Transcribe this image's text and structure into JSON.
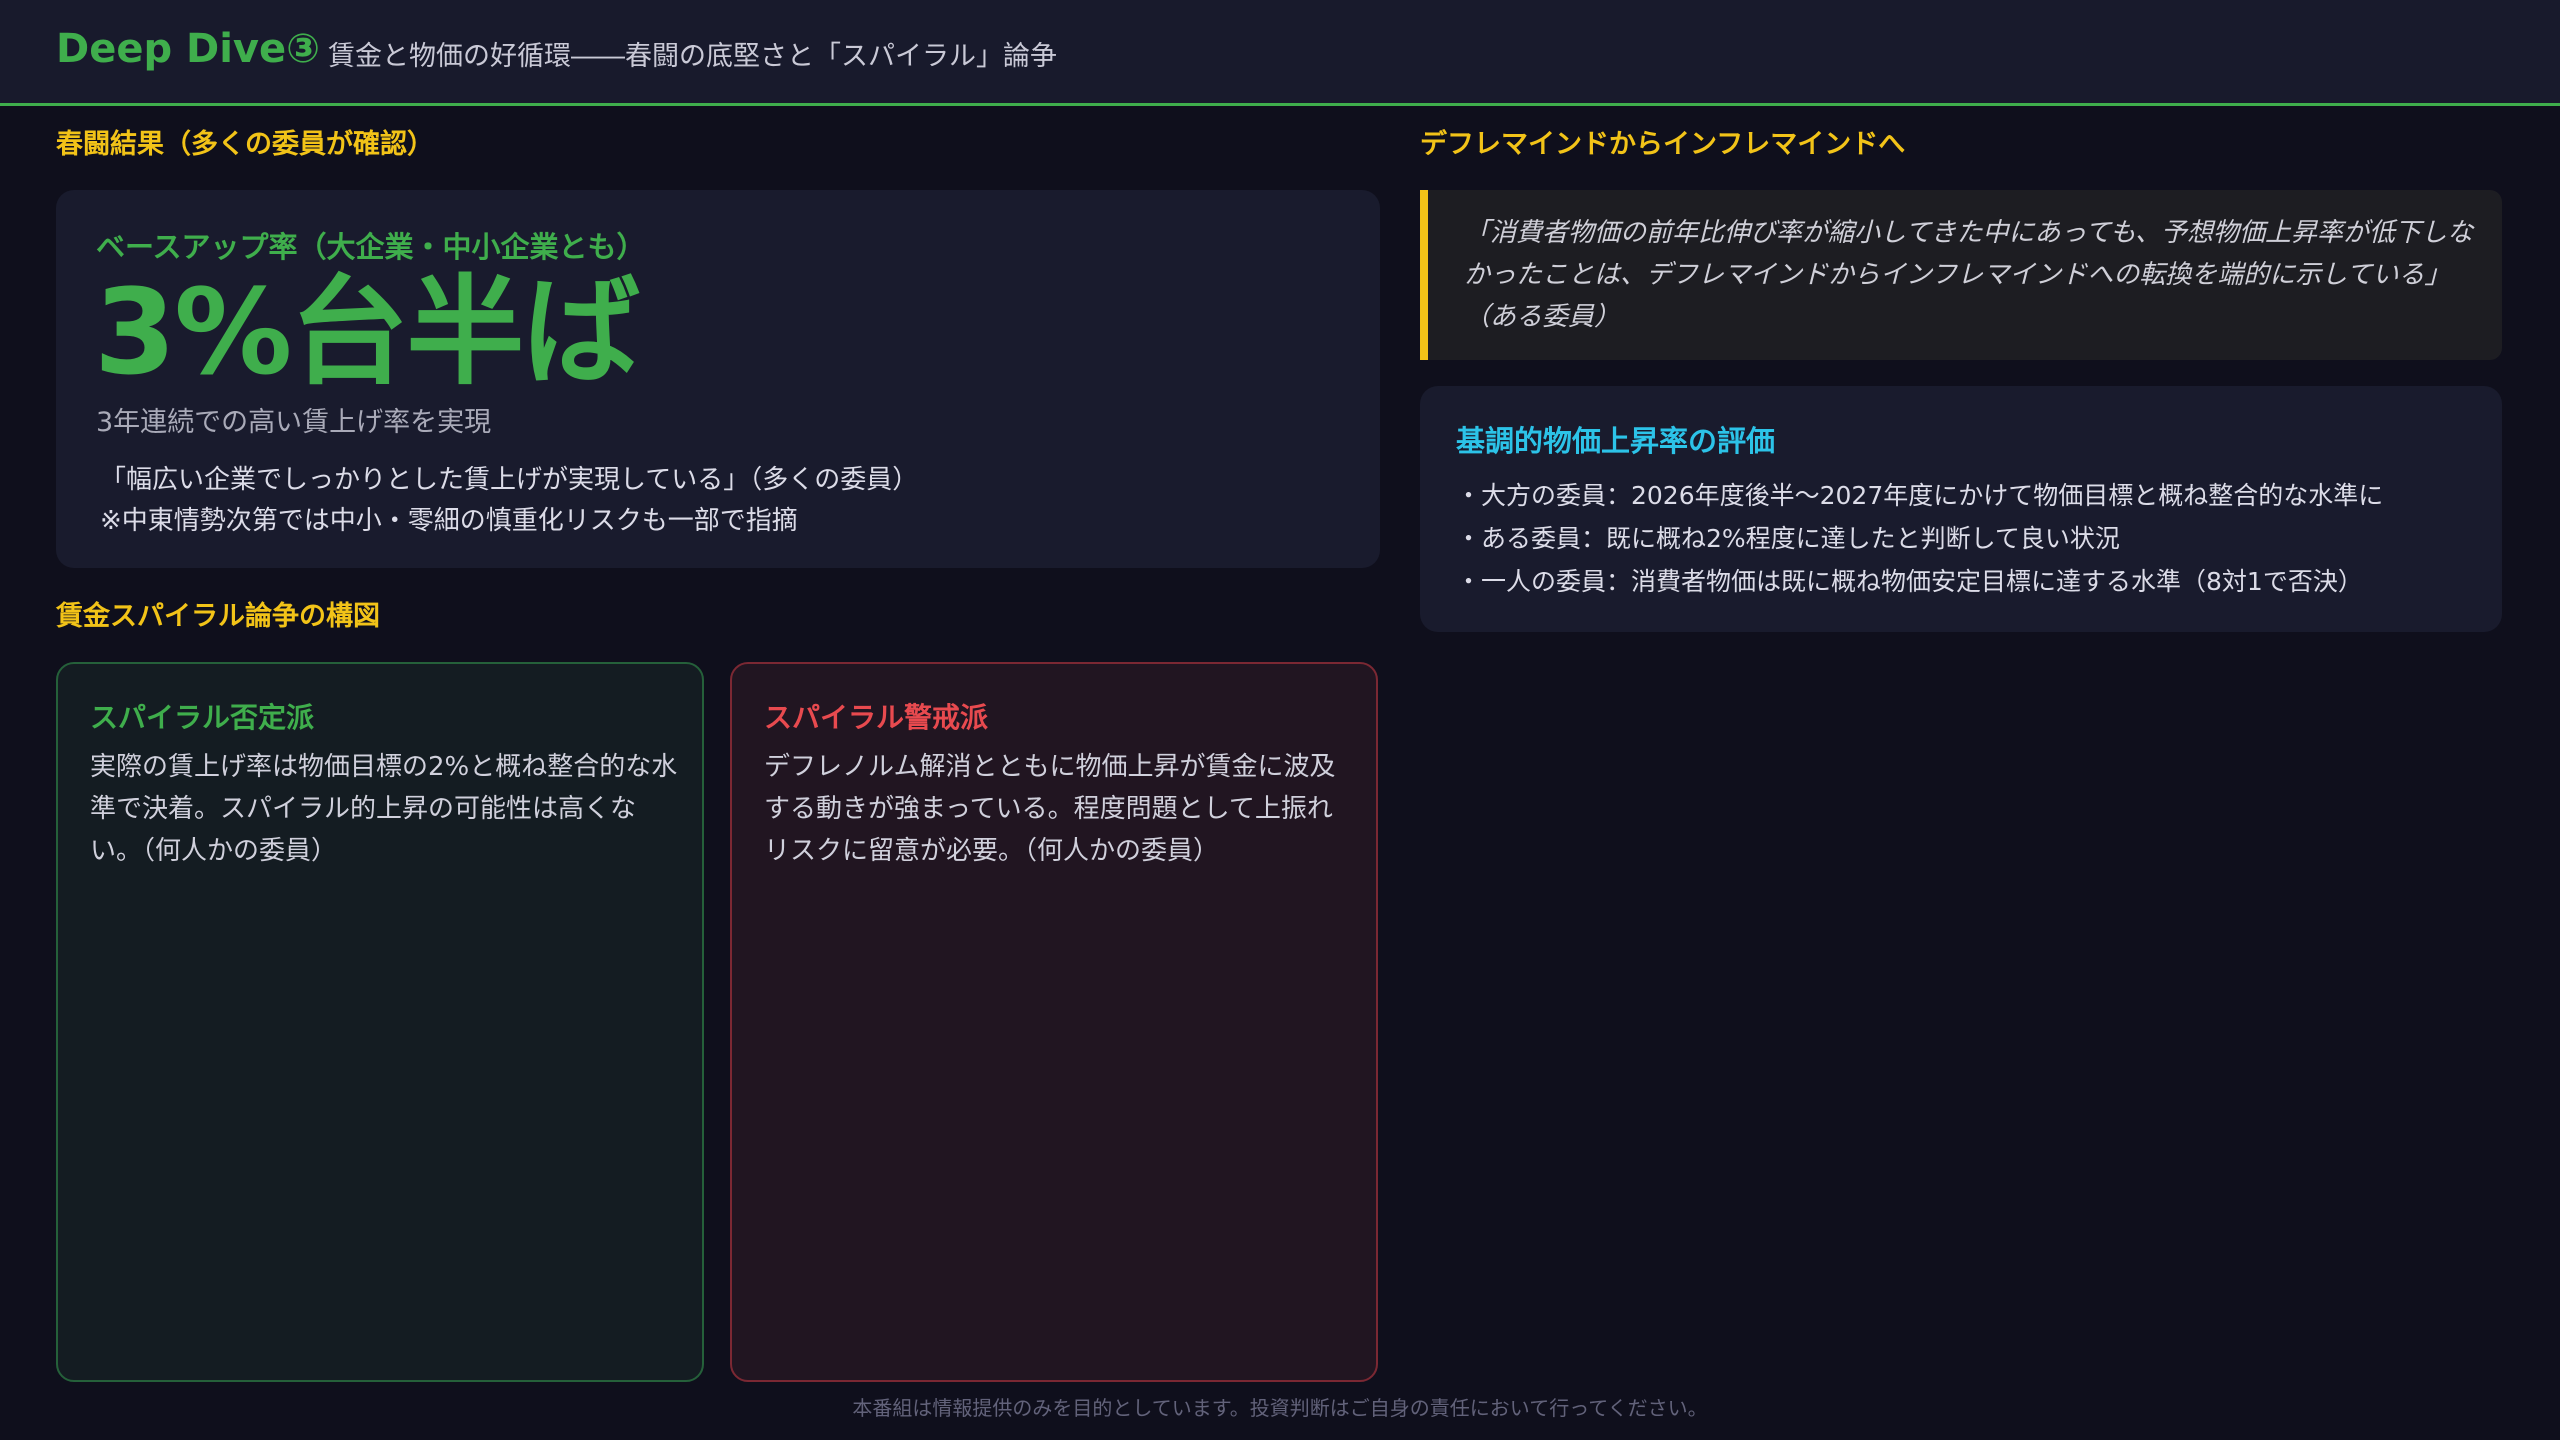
{
  "header": {
    "title": "Deep Dive③",
    "subtitle": "賃金と物価の好循環――春闘の底堅さと「スパイラル」論争"
  },
  "left": {
    "section_results_label": "春闘結果（多くの委員が確認）",
    "results_card": {
      "label": "ベースアップ率（大企業・中小企業とも）",
      "value": "3%台半ば",
      "sub": "3年連続での高い賃上げ率を実現",
      "quote_line1": "「幅広い企業でしっかりとした賃上げが実現している」（多くの委員）",
      "quote_line2": "※中東情勢次第では中小・零細の慎重化リスクも一部で指摘"
    },
    "section_spiral_label": "賃金スパイラル論争の構図",
    "panel_deny": {
      "title": "スパイラル否定派",
      "text": "実際の賃上げ率は物価目標の2%と概ね整合的な水準で決着。スパイラル的上昇の可能性は高くない。（何人かの委員）"
    },
    "panel_warn": {
      "title": "スパイラル警戒派",
      "text": "デフレノルム解消とともに物価上昇が賃金に波及する動きが強まっている。程度問題として上振れリスクに留意が必要。（何人かの委員）"
    }
  },
  "right": {
    "section_label": "デフレマインドからインフレマインドへ",
    "quote": "「消費者物価の前年比伸び率が縮小してきた中にあっても、予想物価上昇率が低下しなかったことは、デフレマインドからインフレマインドへの転換を端的に示している」（ある委員）",
    "eval_card": {
      "title": "基調的物価上昇率の評価",
      "items": [
        "・大方の委員：2026年度後半〜2027年度にかけて物価目標と概ね整合的な水準に",
        "・ある委員：既に概ね2%程度に達したと判断して良い状況",
        "・一人の委員：消費者物価は既に概ね物価安定目標に達する水準（8対1で否決）"
      ]
    }
  },
  "footer": "本番組は情報提供のみを目的としています。投資判断はご自身の責任において行ってください。",
  "colors": {
    "accent_green": "#3fae4c",
    "accent_yellow": "#f2c318",
    "accent_red": "#e84a4f",
    "accent_cyan": "#2cc3e8"
  }
}
